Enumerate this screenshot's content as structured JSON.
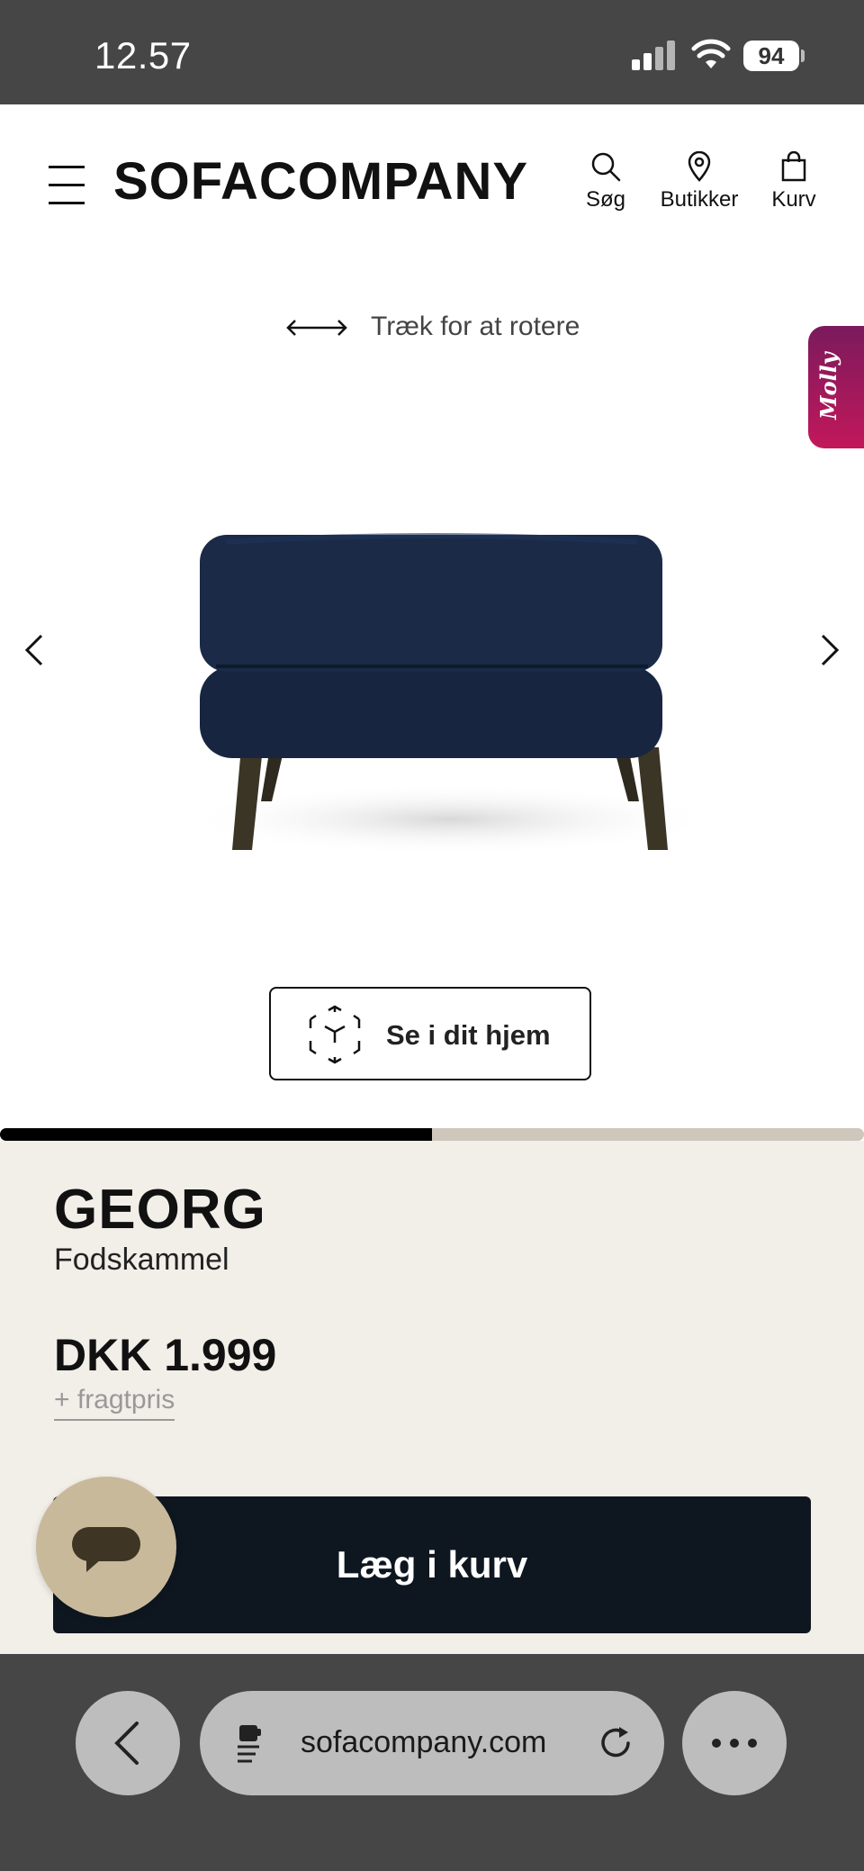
{
  "status_bar": {
    "time": "12.57",
    "battery": "94"
  },
  "header": {
    "logo": "SOFACOMPANY",
    "search_label": "Søg",
    "stores_label": "Butikker",
    "cart_label": "Kurv"
  },
  "viewer": {
    "rotate_hint": "Træk for at rotere",
    "ar_button_label": "Se i dit hjem",
    "molly_label": "Molly",
    "gallery_progress": 0.5
  },
  "product": {
    "name": "GEORG",
    "type": "Fodskammel",
    "price": "DKK 1.999",
    "freight_note": "+ fragtpris",
    "add_to_cart_label": "Læg i kurv"
  },
  "browser": {
    "url": "sofacompany.com"
  },
  "colors": {
    "status_bar_bg": "#464646",
    "info_bg": "#f2eee8",
    "cart_button_bg": "#0e1720",
    "molly_bg": "#c2185b",
    "chat_bg": "#c9b99b"
  }
}
